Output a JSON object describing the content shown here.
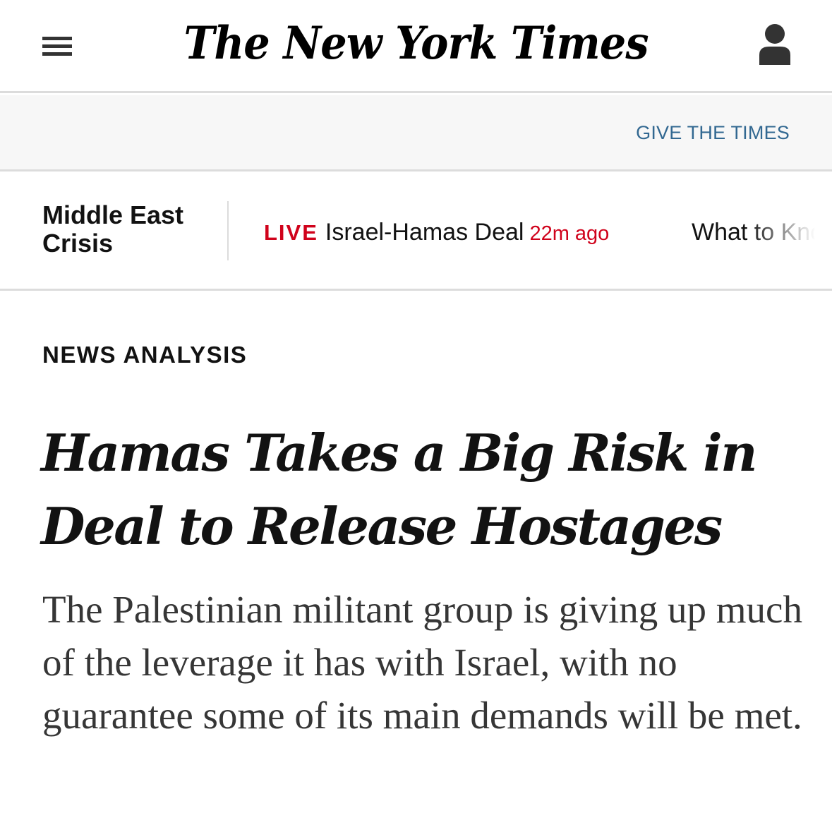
{
  "masthead": {
    "logo_text": "The New York Times"
  },
  "give_bar": {
    "link_label": "GIVE THE TIMES"
  },
  "section_nav": {
    "section_title": "Middle East Crisis",
    "live_tag": "LIVE",
    "live_label": "Israel-Hamas Deal",
    "live_time": "22m ago",
    "next_item": "What to Know"
  },
  "article": {
    "kicker": "NEWS ANALYSIS",
    "headline": "Hamas Takes a Big Risk in Deal to Release Hostages",
    "summary": "The Palestinian militant group is giving up much of the leverage it has with Israel, with no guarantee some of its main demands will be met."
  },
  "colors": {
    "live_red": "#d0021b",
    "link_blue": "#326891",
    "text_dark": "#121212",
    "summary_gray": "#363636"
  }
}
